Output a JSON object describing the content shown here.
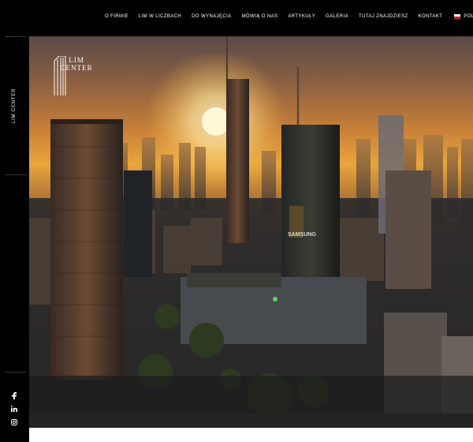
{
  "nav": {
    "items": [
      "O FIRMIE",
      "LIM W LICZBACH",
      "DO WYNAJĘCIA",
      "MÓWIĄ O NAS",
      "ARTYKUŁY",
      "GALERIA",
      "TUTAJ ZNAJDZIESZ",
      "KONTAKT"
    ],
    "language": "POLISH"
  },
  "sidebar": {
    "label": "LIM CENTER",
    "social": [
      "facebook-icon",
      "linkedin-icon",
      "instagram-icon"
    ]
  },
  "hero": {
    "logo_line1": "LIM",
    "logo_line2": "CENTER",
    "samsung_sign": "SAMSUNG"
  },
  "colors": {
    "background": "#000000",
    "sky_glow": "#e9a53b",
    "sun": "#fff6c8"
  }
}
